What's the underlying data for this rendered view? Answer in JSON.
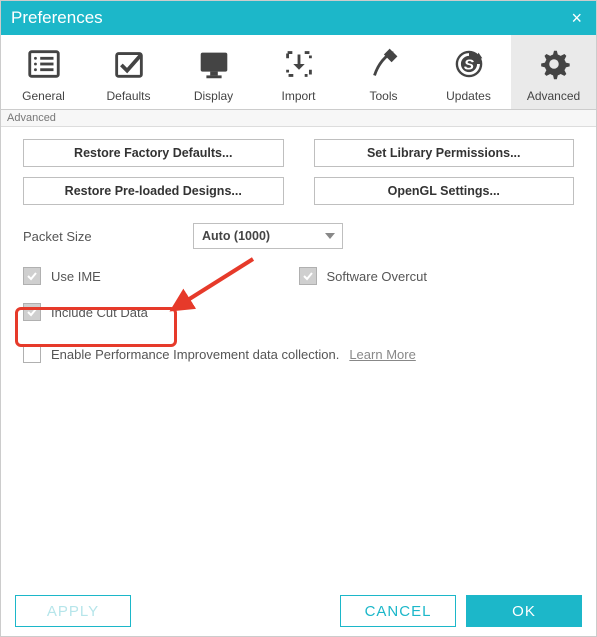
{
  "window": {
    "title": "Preferences"
  },
  "tabs": {
    "t0": "General",
    "t1": "Defaults",
    "t2": "Display",
    "t3": "Import",
    "t4": "Tools",
    "t5": "Updates",
    "t6": "Advanced",
    "active": "Advanced"
  },
  "section": {
    "label": "Advanced"
  },
  "buttons": {
    "restore_factory": "Restore Factory Defaults...",
    "set_library": "Set Library Permissions...",
    "restore_preloaded": "Restore Pre-loaded Designs...",
    "opengl": "OpenGL Settings..."
  },
  "packet": {
    "label": "Packet Size",
    "value": "Auto (1000)"
  },
  "checks": {
    "use_ime": "Use IME",
    "software_overcut": "Software Overcut",
    "include_cut": "Include Cut Data",
    "enable_perf": "Enable Performance Improvement data collection.",
    "learn_more": "Learn More"
  },
  "footer": {
    "apply": "APPLY",
    "cancel": "CANCEL",
    "ok": "OK"
  }
}
